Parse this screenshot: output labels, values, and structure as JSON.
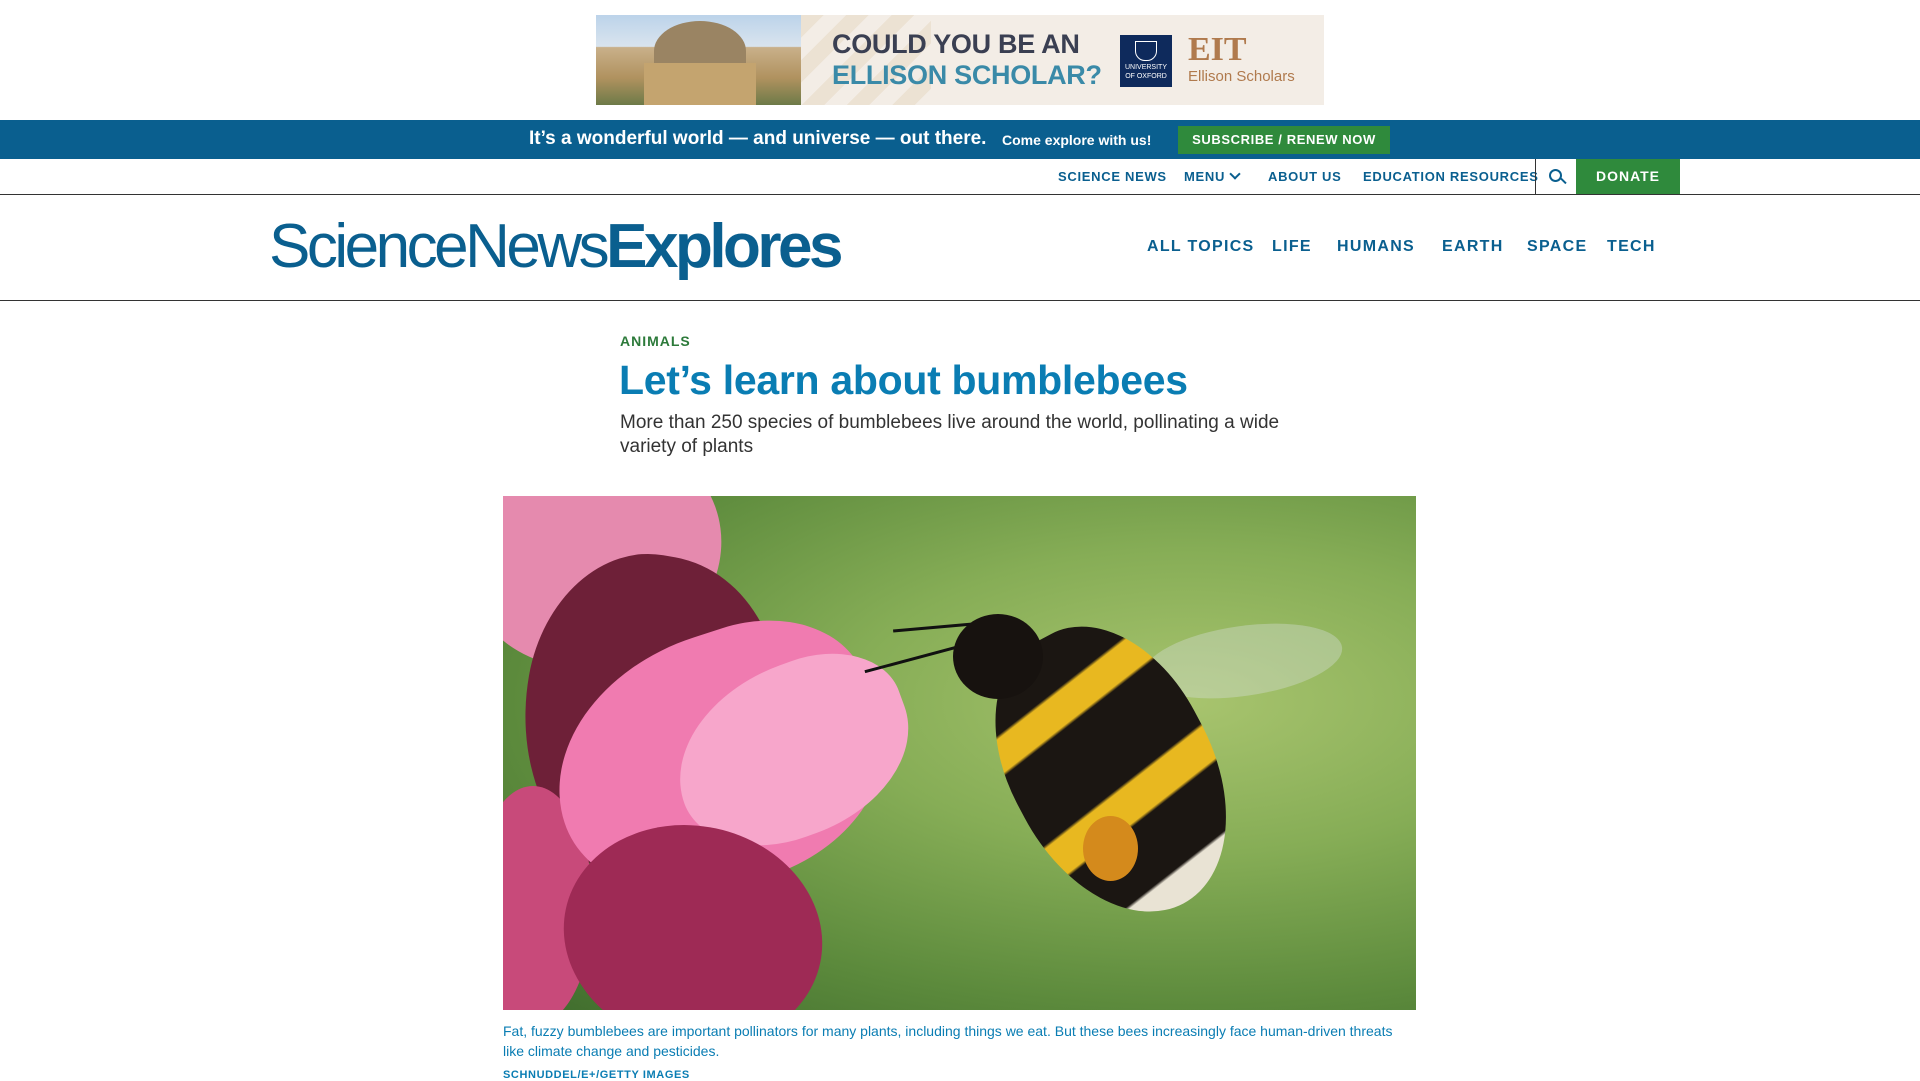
{
  "ad": {
    "line1": "COULD YOU BE AN",
    "line2": "ELLISON SCHOLAR?",
    "oxford": "UNIVERSITY OF OXFORD",
    "eit": "EIT",
    "eit_sub": "Ellison Scholars"
  },
  "promo": {
    "headline": "It’s a wonderful world — and universe — out there.",
    "sub": "Come explore with us!",
    "button": "SUBSCRIBE / RENEW NOW"
  },
  "utility_nav": {
    "items": [
      "SCIENCE NEWS",
      "MENU",
      "ABOUT US",
      "EDUCATION RESOURCES"
    ],
    "donate": "DONATE",
    "search_icon": "search-icon"
  },
  "header": {
    "logo_part1": "ScienceNews",
    "logo_part2": "Explores",
    "nav": [
      "ALL TOPICS",
      "LIFE",
      "HUMANS",
      "EARTH",
      "SPACE",
      "TECH"
    ]
  },
  "article": {
    "kicker": "ANIMALS",
    "title": "Let’s learn about bumblebees",
    "dek": "More than 250 species of bumblebees live around the world, pollinating a wide variety of plants",
    "caption": "Fat, fuzzy bumblebees are important pollinators for many plants, including things we eat. But these bees increasingly face human-driven threats like climate change and pesticides.",
    "credit": "SCHNUDDEL/E+/GETTY IMAGES"
  },
  "colors": {
    "brand_blue": "#0a5f8f",
    "title_blue": "#0a7db3",
    "green": "#2f8a3c"
  }
}
